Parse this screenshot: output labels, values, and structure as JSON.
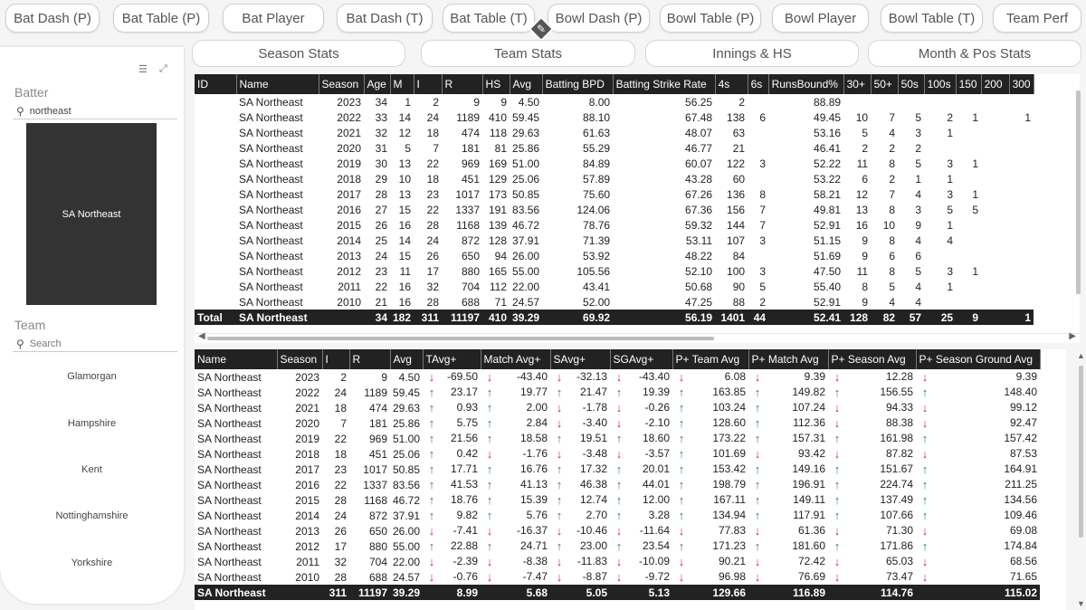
{
  "nav": [
    "Bat Dash (P)",
    "Bat Table (P)",
    "Bat Player",
    "Bat Dash (T)",
    "Bat Table (T)",
    "Bowl Dash (P)",
    "Bowl Table (P)",
    "Bowl Player",
    "Bowl Table (T)",
    "Team Perf"
  ],
  "subnav": [
    "Season Stats",
    "Team Stats",
    "Innings & HS",
    "Month & Pos Stats"
  ],
  "slicers": {
    "batter_title": "Batter",
    "batter_search_value": "northeast",
    "batter_selected": "SA Northeast",
    "team_title": "Team",
    "team_search_placeholder": "Search",
    "teams": [
      "Glamorgan",
      "Hampshire",
      "Kent",
      "Nottinghamshire",
      "Yorkshire"
    ]
  },
  "table1": {
    "headers": [
      "ID",
      "Name",
      "Season",
      "Age",
      "M",
      "I",
      "R",
      "HS",
      "Avg",
      "Batting BPD",
      "Batting Strike Rate",
      "4s",
      "6s",
      "RunsBound%",
      "30+",
      "50+",
      "50s",
      "100s",
      "150",
      "200",
      "300"
    ],
    "rows": [
      [
        "",
        "SA Northeast",
        "2023",
        "34",
        "1",
        "2",
        "9",
        "9",
        "4.50",
        "8.00",
        "56.25",
        "2",
        "",
        "88.89",
        "",
        "",
        "",
        "",
        "",
        "",
        ""
      ],
      [
        "",
        "SA Northeast",
        "2022",
        "33",
        "14",
        "24",
        "1189",
        "410",
        "59.45",
        "88.10",
        "67.48",
        "138",
        "6",
        "49.45",
        "10",
        "7",
        "5",
        "2",
        "1",
        "",
        "1"
      ],
      [
        "",
        "SA Northeast",
        "2021",
        "32",
        "12",
        "18",
        "474",
        "118",
        "29.63",
        "61.63",
        "48.07",
        "63",
        "",
        "53.16",
        "5",
        "4",
        "3",
        "1",
        "",
        "",
        ""
      ],
      [
        "",
        "SA Northeast",
        "2020",
        "31",
        "5",
        "7",
        "181",
        "81",
        "25.86",
        "55.29",
        "46.77",
        "21",
        "",
        "46.41",
        "2",
        "2",
        "2",
        "",
        "",
        "",
        ""
      ],
      [
        "",
        "SA Northeast",
        "2019",
        "30",
        "13",
        "22",
        "969",
        "169",
        "51.00",
        "84.89",
        "60.07",
        "122",
        "3",
        "52.22",
        "11",
        "8",
        "5",
        "3",
        "1",
        "",
        ""
      ],
      [
        "",
        "SA Northeast",
        "2018",
        "29",
        "10",
        "18",
        "451",
        "129",
        "25.06",
        "57.89",
        "43.28",
        "60",
        "",
        "53.22",
        "6",
        "2",
        "1",
        "1",
        "",
        "",
        ""
      ],
      [
        "",
        "SA Northeast",
        "2017",
        "28",
        "13",
        "23",
        "1017",
        "173",
        "50.85",
        "75.60",
        "67.26",
        "136",
        "8",
        "58.21",
        "12",
        "7",
        "4",
        "3",
        "1",
        "",
        ""
      ],
      [
        "",
        "SA Northeast",
        "2016",
        "27",
        "15",
        "22",
        "1337",
        "191",
        "83.56",
        "124.06",
        "67.36",
        "156",
        "7",
        "49.81",
        "13",
        "8",
        "3",
        "5",
        "5",
        "",
        ""
      ],
      [
        "",
        "SA Northeast",
        "2015",
        "26",
        "16",
        "28",
        "1168",
        "139",
        "46.72",
        "78.76",
        "59.32",
        "144",
        "7",
        "52.91",
        "16",
        "10",
        "9",
        "1",
        "",
        "",
        ""
      ],
      [
        "",
        "SA Northeast",
        "2014",
        "25",
        "14",
        "24",
        "872",
        "128",
        "37.91",
        "71.39",
        "53.11",
        "107",
        "3",
        "51.15",
        "9",
        "8",
        "4",
        "4",
        "",
        "",
        ""
      ],
      [
        "",
        "SA Northeast",
        "2013",
        "24",
        "15",
        "26",
        "650",
        "94",
        "26.00",
        "53.92",
        "48.22",
        "84",
        "",
        "51.69",
        "9",
        "6",
        "6",
        "",
        "",
        "",
        ""
      ],
      [
        "",
        "SA Northeast",
        "2012",
        "23",
        "11",
        "17",
        "880",
        "165",
        "55.00",
        "105.56",
        "52.10",
        "100",
        "3",
        "47.50",
        "11",
        "8",
        "5",
        "3",
        "1",
        "",
        ""
      ],
      [
        "",
        "SA Northeast",
        "2011",
        "22",
        "16",
        "32",
        "704",
        "112",
        "22.00",
        "43.41",
        "50.68",
        "90",
        "5",
        "55.40",
        "8",
        "5",
        "4",
        "1",
        "",
        "",
        ""
      ],
      [
        "",
        "SA Northeast",
        "2010",
        "21",
        "16",
        "28",
        "688",
        "71",
        "24.57",
        "52.00",
        "47.25",
        "88",
        "2",
        "52.91",
        "9",
        "4",
        "4",
        "",
        "",
        "",
        ""
      ]
    ],
    "total": [
      "Total",
      "SA Northeast",
      "",
      "34",
      "182",
      "311",
      "11197",
      "410",
      "39.29",
      "69.92",
      "56.19",
      "1401",
      "44",
      "52.41",
      "128",
      "82",
      "57",
      "25",
      "9",
      "",
      "1"
    ]
  },
  "table2": {
    "headers": [
      "Name",
      "Season",
      "I",
      "R",
      "Avg",
      "TAvg+",
      "Match Avg+",
      "SAvg+",
      "SGAvg+",
      "P+ Team Avg",
      "P+ Match Avg",
      "P+ Season Avg",
      "P+ Season Ground Avg"
    ],
    "rows": [
      [
        "SA Northeast",
        "2023",
        "2",
        "9",
        "4.50",
        [
          "down",
          "-69.50"
        ],
        [
          "down",
          "-43.40"
        ],
        [
          "down",
          "-32.13"
        ],
        [
          "down",
          "-43.40"
        ],
        [
          "down",
          "6.08"
        ],
        [
          "down",
          "9.39"
        ],
        [
          "down",
          "12.28"
        ],
        [
          "down",
          "9.39"
        ]
      ],
      [
        "SA Northeast",
        "2022",
        "24",
        "1189",
        "59.45",
        [
          "up",
          "23.17"
        ],
        [
          "up",
          "19.77"
        ],
        [
          "up",
          "21.47"
        ],
        [
          "up",
          "19.39"
        ],
        [
          "up",
          "163.85"
        ],
        [
          "up",
          "149.82"
        ],
        [
          "up",
          "156.55"
        ],
        [
          "up",
          "148.40"
        ]
      ],
      [
        "SA Northeast",
        "2021",
        "18",
        "474",
        "29.63",
        [
          "up",
          "0.93"
        ],
        [
          "up",
          "2.00"
        ],
        [
          "down",
          "-1.78"
        ],
        [
          "down",
          "-0.26"
        ],
        [
          "up",
          "103.24"
        ],
        [
          "up",
          "107.24"
        ],
        [
          "down",
          "94.33"
        ],
        [
          "down",
          "99.12"
        ]
      ],
      [
        "SA Northeast",
        "2020",
        "7",
        "181",
        "25.86",
        [
          "up",
          "5.75"
        ],
        [
          "up",
          "2.84"
        ],
        [
          "down",
          "-3.40"
        ],
        [
          "down",
          "-2.10"
        ],
        [
          "up",
          "128.60"
        ],
        [
          "up",
          "112.36"
        ],
        [
          "down",
          "88.38"
        ],
        [
          "down",
          "92.47"
        ]
      ],
      [
        "SA Northeast",
        "2019",
        "22",
        "969",
        "51.00",
        [
          "up",
          "21.56"
        ],
        [
          "up",
          "18.58"
        ],
        [
          "up",
          "19.51"
        ],
        [
          "up",
          "18.60"
        ],
        [
          "up",
          "173.22"
        ],
        [
          "up",
          "157.31"
        ],
        [
          "up",
          "161.98"
        ],
        [
          "up",
          "157.42"
        ]
      ],
      [
        "SA Northeast",
        "2018",
        "18",
        "451",
        "25.06",
        [
          "up",
          "0.42"
        ],
        [
          "down",
          "-1.76"
        ],
        [
          "down",
          "-3.48"
        ],
        [
          "down",
          "-3.57"
        ],
        [
          "up",
          "101.69"
        ],
        [
          "down",
          "93.42"
        ],
        [
          "down",
          "87.82"
        ],
        [
          "down",
          "87.53"
        ]
      ],
      [
        "SA Northeast",
        "2017",
        "23",
        "1017",
        "50.85",
        [
          "up",
          "17.71"
        ],
        [
          "up",
          "16.76"
        ],
        [
          "up",
          "17.32"
        ],
        [
          "up",
          "20.01"
        ],
        [
          "up",
          "153.42"
        ],
        [
          "up",
          "149.16"
        ],
        [
          "up",
          "151.67"
        ],
        [
          "up",
          "164.91"
        ]
      ],
      [
        "SA Northeast",
        "2016",
        "22",
        "1337",
        "83.56",
        [
          "up",
          "41.53"
        ],
        [
          "up",
          "41.13"
        ],
        [
          "up",
          "46.38"
        ],
        [
          "up",
          "44.01"
        ],
        [
          "up",
          "198.79"
        ],
        [
          "up",
          "196.91"
        ],
        [
          "up",
          "224.74"
        ],
        [
          "up",
          "211.25"
        ]
      ],
      [
        "SA Northeast",
        "2015",
        "28",
        "1168",
        "46.72",
        [
          "up",
          "18.76"
        ],
        [
          "up",
          "15.39"
        ],
        [
          "up",
          "12.74"
        ],
        [
          "up",
          "12.00"
        ],
        [
          "up",
          "167.11"
        ],
        [
          "up",
          "149.11"
        ],
        [
          "up",
          "137.49"
        ],
        [
          "up",
          "134.56"
        ]
      ],
      [
        "SA Northeast",
        "2014",
        "24",
        "872",
        "37.91",
        [
          "up",
          "9.82"
        ],
        [
          "up",
          "5.76"
        ],
        [
          "up",
          "2.70"
        ],
        [
          "up",
          "3.28"
        ],
        [
          "up",
          "134.94"
        ],
        [
          "up",
          "117.91"
        ],
        [
          "up",
          "107.66"
        ],
        [
          "up",
          "109.46"
        ]
      ],
      [
        "SA Northeast",
        "2013",
        "26",
        "650",
        "26.00",
        [
          "down",
          "-7.41"
        ],
        [
          "down",
          "-16.37"
        ],
        [
          "down",
          "-10.46"
        ],
        [
          "down",
          "-11.64"
        ],
        [
          "down",
          "77.83"
        ],
        [
          "down",
          "61.36"
        ],
        [
          "down",
          "71.30"
        ],
        [
          "down",
          "69.08"
        ]
      ],
      [
        "SA Northeast",
        "2012",
        "17",
        "880",
        "55.00",
        [
          "up",
          "22.88"
        ],
        [
          "up",
          "24.71"
        ],
        [
          "up",
          "23.00"
        ],
        [
          "up",
          "23.54"
        ],
        [
          "up",
          "171.23"
        ],
        [
          "up",
          "181.60"
        ],
        [
          "up",
          "171.86"
        ],
        [
          "up",
          "174.84"
        ]
      ],
      [
        "SA Northeast",
        "2011",
        "32",
        "704",
        "22.00",
        [
          "down",
          "-2.39"
        ],
        [
          "down",
          "-8.38"
        ],
        [
          "down",
          "-11.83"
        ],
        [
          "down",
          "-10.09"
        ],
        [
          "down",
          "90.21"
        ],
        [
          "down",
          "72.42"
        ],
        [
          "down",
          "65.03"
        ],
        [
          "down",
          "68.56"
        ]
      ],
      [
        "SA Northeast",
        "2010",
        "28",
        "688",
        "24.57",
        [
          "down",
          "-0.76"
        ],
        [
          "down",
          "-7.47"
        ],
        [
          "down",
          "-8.87"
        ],
        [
          "down",
          "-9.72"
        ],
        [
          "down",
          "96.98"
        ],
        [
          "down",
          "76.69"
        ],
        [
          "down",
          "73.47"
        ],
        [
          "down",
          "71.65"
        ]
      ]
    ],
    "total": [
      "SA Northeast",
      "",
      "311",
      "11197",
      "39.29",
      "8.99",
      "5.68",
      "5.05",
      "5.13",
      "129.66",
      "116.89",
      "114.76",
      "115.02"
    ]
  },
  "colors": {
    "up": "#2e8b3a",
    "down": "#d42a2a",
    "header": "#222222"
  }
}
